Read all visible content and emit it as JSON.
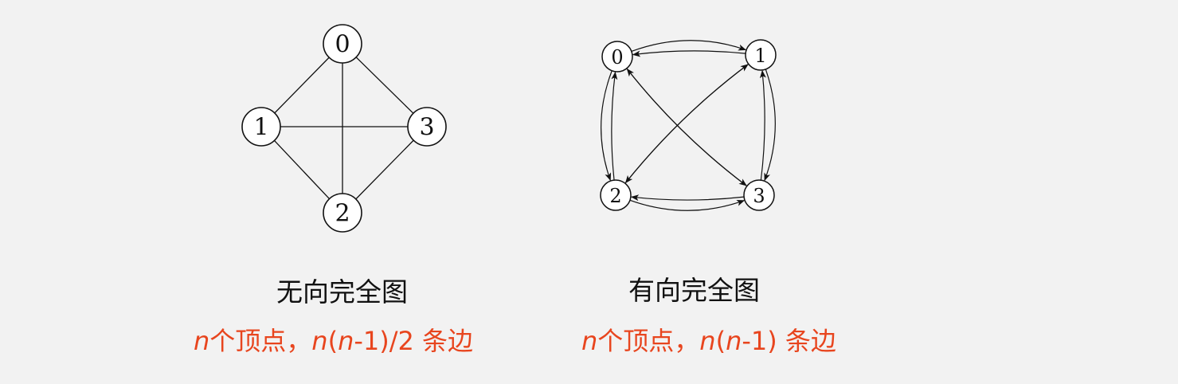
{
  "colors": {
    "background": "#f2f2f2",
    "ink": "#111111",
    "accent": "#e8451e"
  },
  "undirected": {
    "title": "无向完全图",
    "formula": {
      "var": "n",
      "text1": "个顶点，",
      "var2": "n",
      "paren_open": "(",
      "var3": "n",
      "tail": "-1)/2 条边"
    },
    "nodes": [
      {
        "id": "0",
        "label": "0"
      },
      {
        "id": "1",
        "label": "1"
      },
      {
        "id": "2",
        "label": "2"
      },
      {
        "id": "3",
        "label": "3"
      }
    ],
    "edges": [
      [
        "0",
        "1"
      ],
      [
        "0",
        "2"
      ],
      [
        "0",
        "3"
      ],
      [
        "1",
        "2"
      ],
      [
        "1",
        "3"
      ],
      [
        "2",
        "3"
      ]
    ]
  },
  "directed": {
    "title": "有向完全图",
    "formula": {
      "var": "n",
      "text1": "个顶点，",
      "var2": "n",
      "paren_open": "(",
      "var3": "n",
      "tail": "-1) 条边"
    },
    "nodes": [
      {
        "id": "0",
        "label": "0"
      },
      {
        "id": "1",
        "label": "1"
      },
      {
        "id": "2",
        "label": "2"
      },
      {
        "id": "3",
        "label": "3"
      }
    ],
    "arcs": [
      [
        "0",
        "1"
      ],
      [
        "1",
        "0"
      ],
      [
        "0",
        "2"
      ],
      [
        "2",
        "0"
      ],
      [
        "0",
        "3"
      ],
      [
        "3",
        "0"
      ],
      [
        "1",
        "2"
      ],
      [
        "2",
        "1"
      ],
      [
        "1",
        "3"
      ],
      [
        "3",
        "1"
      ],
      [
        "2",
        "3"
      ],
      [
        "3",
        "2"
      ]
    ]
  }
}
